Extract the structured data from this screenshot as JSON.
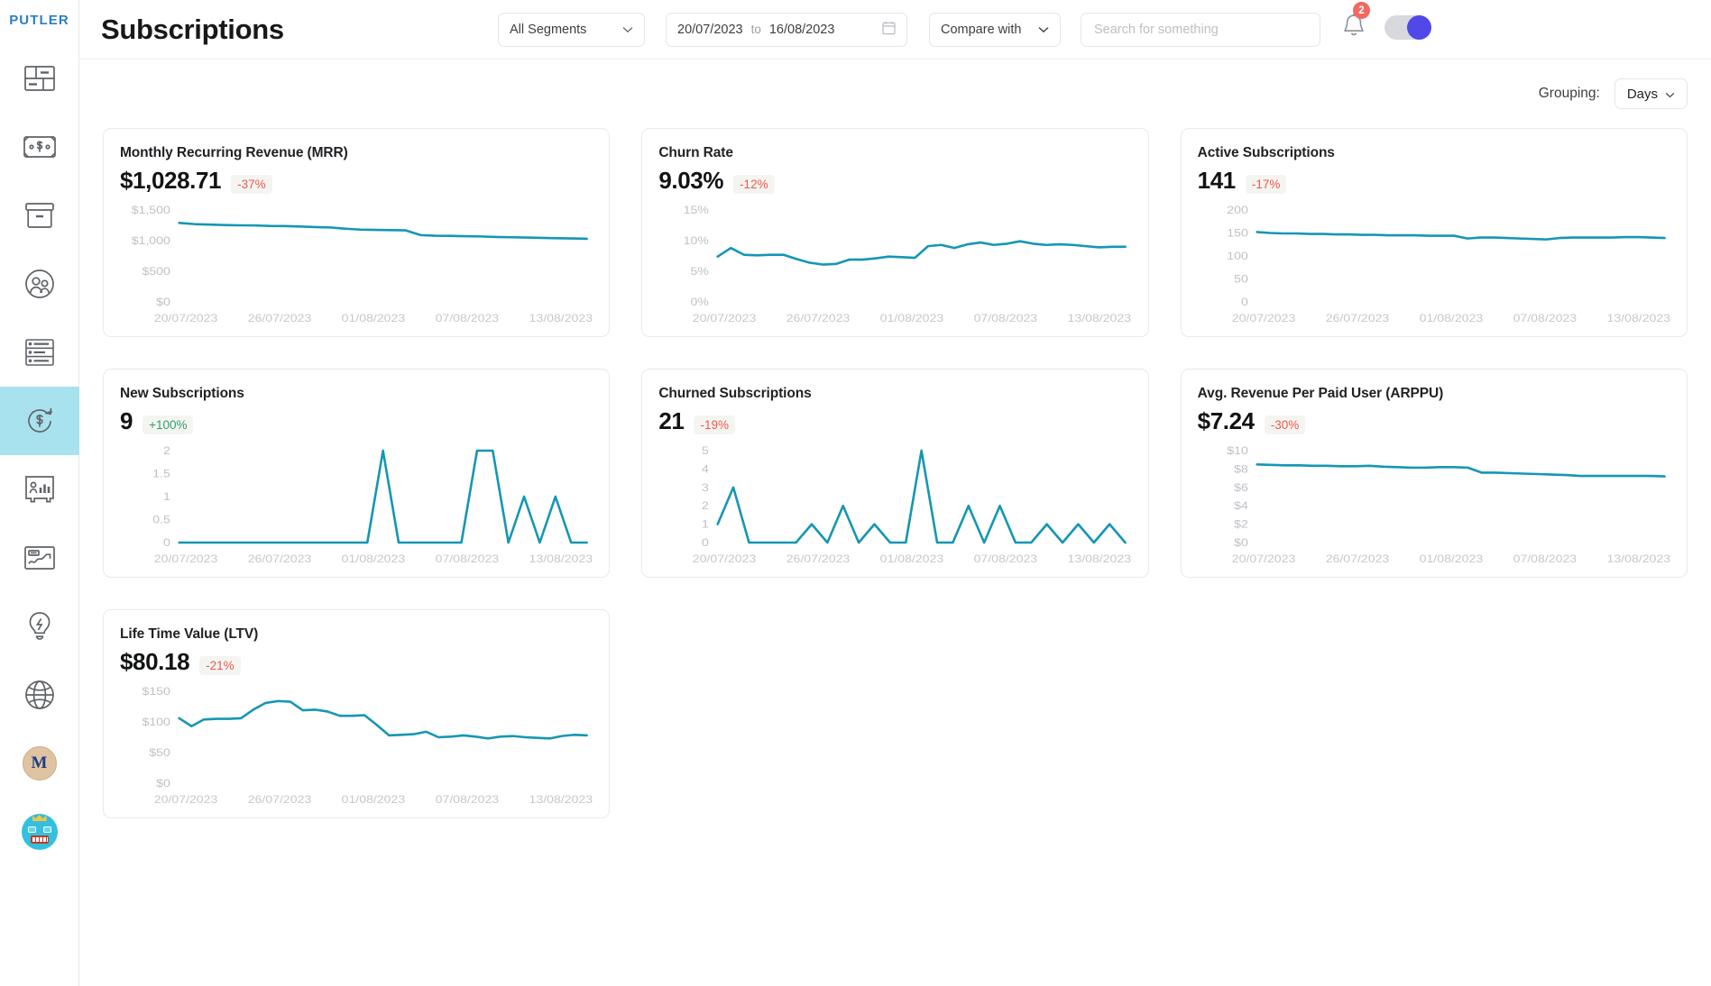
{
  "brand": "PUTLER",
  "sidebar": {
    "items": [
      {
        "name": "dashboard",
        "icon": "dashboard-icon",
        "active": false
      },
      {
        "name": "sales",
        "icon": "money-bill-icon",
        "active": false
      },
      {
        "name": "products",
        "icon": "box-icon",
        "active": false
      },
      {
        "name": "customers",
        "icon": "people-icon",
        "active": false
      },
      {
        "name": "transactions",
        "icon": "list-rows-icon",
        "active": false
      },
      {
        "name": "subscriptions",
        "icon": "dollar-refresh-icon",
        "active": true
      },
      {
        "name": "audience",
        "icon": "person-chart-icon",
        "active": false
      },
      {
        "name": "insights",
        "icon": "trend-chart-icon",
        "active": false
      },
      {
        "name": "ideas",
        "icon": "lightbulb-icon",
        "active": false
      },
      {
        "name": "web-analytics",
        "icon": "globe-icon",
        "active": false
      }
    ],
    "account_initial": "M"
  },
  "header": {
    "title": "Subscriptions",
    "segment_value": "All Segments",
    "date_from": "20/07/2023",
    "date_to_label": "to",
    "date_to": "16/08/2023",
    "compare_label": "Compare with",
    "search_placeholder": "Search for something",
    "search_value": "",
    "notification_count": "2",
    "toggle_on": true
  },
  "toolbar": {
    "grouping_label": "Grouping:",
    "grouping_value": "Days"
  },
  "colors": {
    "line": "#1596b4",
    "accent": "#2b7fc2",
    "active_nav": "#a9e2ef",
    "negative": "#f0574d",
    "positive": "#2e9e73",
    "badge": "#f4685f",
    "toggle_knob": "#5248e8"
  },
  "chart_data": [
    {
      "type": "line",
      "title": "Monthly Recurring Revenue (MRR)",
      "value": "$1,028.71",
      "delta": "-37%",
      "delta_sign": "neg",
      "xlabel": "",
      "ylabel": "",
      "ylim": [
        0,
        1500
      ],
      "yticks": [
        0,
        500,
        1000,
        1500
      ],
      "ytick_labels": [
        "$0",
        "$500",
        "$1,000",
        "$1,500"
      ],
      "xtick_labels": [
        "20/07/2023",
        "26/07/2023",
        "01/08/2023",
        "07/08/2023",
        "13/08/2023"
      ],
      "grid": false,
      "values": [
        1290,
        1270,
        1262,
        1255,
        1250,
        1248,
        1240,
        1238,
        1230,
        1222,
        1215,
        1195,
        1180,
        1175,
        1172,
        1168,
        1090,
        1080,
        1078,
        1072,
        1068,
        1060,
        1055,
        1050,
        1045,
        1040,
        1036,
        1030
      ]
    },
    {
      "type": "line",
      "title": "Churn Rate",
      "value": "9.03%",
      "delta": "-12%",
      "delta_sign": "neg",
      "xlabel": "",
      "ylabel": "",
      "ylim": [
        0,
        15
      ],
      "yticks": [
        0,
        5,
        10,
        15
      ],
      "ytick_labels": [
        "0%",
        "5%",
        "10%",
        "15%"
      ],
      "xtick_labels": [
        "20/07/2023",
        "26/07/2023",
        "01/08/2023",
        "07/08/2023",
        "13/08/2023"
      ],
      "grid": false,
      "values": [
        7.4,
        8.8,
        7.7,
        7.6,
        7.7,
        7.7,
        7.0,
        6.4,
        6.1,
        6.2,
        6.9,
        6.9,
        7.1,
        7.4,
        7.3,
        7.2,
        9.1,
        9.3,
        8.8,
        9.4,
        9.7,
        9.3,
        9.5,
        9.9,
        9.5,
        9.3,
        9.4,
        9.3,
        9.1,
        8.9,
        9.0,
        9.0
      ]
    },
    {
      "type": "line",
      "title": "Active Subscriptions",
      "value": "141",
      "delta": "-17%",
      "delta_sign": "neg",
      "xlabel": "",
      "ylabel": "",
      "ylim": [
        0,
        200
      ],
      "yticks": [
        0,
        50,
        100,
        150,
        200
      ],
      "ytick_labels": [
        "0",
        "50",
        "100",
        "150",
        "200"
      ],
      "xtick_labels": [
        "20/07/2023",
        "26/07/2023",
        "01/08/2023",
        "07/08/2023",
        "13/08/2023"
      ],
      "grid": false,
      "values": [
        152,
        150,
        149,
        149,
        148,
        148,
        147,
        147,
        146,
        146,
        145,
        145,
        145,
        144,
        144,
        144,
        138,
        140,
        140,
        139,
        138,
        137,
        136,
        139,
        140,
        140,
        140,
        140,
        141,
        141,
        140,
        139
      ]
    },
    {
      "type": "line",
      "title": "New Subscriptions",
      "value": "9",
      "delta": "+100%",
      "delta_sign": "pos",
      "xlabel": "",
      "ylabel": "",
      "ylim": [
        0,
        2
      ],
      "yticks": [
        0,
        0.5,
        1,
        1.5,
        2
      ],
      "ytick_labels": [
        "0",
        "0.5",
        "1",
        "1.5",
        "2"
      ],
      "xtick_labels": [
        "20/07/2023",
        "26/07/2023",
        "01/08/2023",
        "07/08/2023",
        "13/08/2023"
      ],
      "grid": false,
      "values": [
        0,
        0,
        0,
        0,
        0,
        0,
        0,
        0,
        0,
        0,
        0,
        0,
        0,
        2,
        0,
        0,
        0,
        0,
        0,
        2,
        2,
        0,
        1,
        0,
        1,
        0,
        0
      ]
    },
    {
      "type": "line",
      "title": "Churned Subscriptions",
      "value": "21",
      "delta": "-19%",
      "delta_sign": "neg",
      "xlabel": "",
      "ylabel": "",
      "ylim": [
        0,
        5
      ],
      "yticks": [
        0,
        1,
        2,
        3,
        4,
        5
      ],
      "ytick_labels": [
        "0",
        "1",
        "2",
        "3",
        "4",
        "5"
      ],
      "xtick_labels": [
        "20/07/2023",
        "26/07/2023",
        "01/08/2023",
        "07/08/2023",
        "13/08/2023"
      ],
      "grid": false,
      "values": [
        1,
        3,
        0,
        0,
        0,
        0,
        1,
        0,
        2,
        0,
        1,
        0,
        0,
        5,
        0,
        0,
        2,
        0,
        2,
        0,
        0,
        1,
        0,
        1,
        0,
        1,
        0
      ]
    },
    {
      "type": "line",
      "title": "Avg. Revenue Per Paid User (ARPPU)",
      "value": "$7.24",
      "delta": "-30%",
      "delta_sign": "neg",
      "xlabel": "",
      "ylabel": "",
      "ylim": [
        0,
        10
      ],
      "yticks": [
        0,
        2,
        4,
        6,
        8,
        10
      ],
      "ytick_labels": [
        "$0",
        "$2",
        "$4",
        "$6",
        "$8",
        "$10"
      ],
      "xtick_labels": [
        "20/07/2023",
        "26/07/2023",
        "01/08/2023",
        "07/08/2023",
        "13/08/2023"
      ],
      "grid": false,
      "values": [
        8.5,
        8.45,
        8.4,
        8.4,
        8.35,
        8.35,
        8.3,
        8.3,
        8.35,
        8.25,
        8.2,
        8.15,
        8.15,
        8.2,
        8.2,
        8.15,
        7.6,
        7.6,
        7.55,
        7.5,
        7.45,
        7.4,
        7.35,
        7.25,
        7.25,
        7.25,
        7.25,
        7.25,
        7.25,
        7.2
      ]
    },
    {
      "type": "line",
      "title": "Life Time Value (LTV)",
      "value": "$80.18",
      "delta": "-21%",
      "delta_sign": "neg",
      "xlabel": "",
      "ylabel": "",
      "ylim": [
        0,
        150
      ],
      "yticks": [
        0,
        50,
        100,
        150
      ],
      "ytick_labels": [
        "$0",
        "$50",
        "$100",
        "$150"
      ],
      "xtick_labels": [
        "20/07/2023",
        "26/07/2023",
        "01/08/2023",
        "07/08/2023",
        "13/08/2023"
      ],
      "grid": false,
      "values": [
        106,
        93,
        104,
        105,
        105,
        106,
        120,
        131,
        134,
        133,
        119,
        120,
        117,
        110,
        110,
        111,
        95,
        78,
        79,
        80,
        84,
        75,
        76,
        78,
        76,
        73,
        76,
        77,
        75,
        74,
        73,
        77,
        79,
        78
      ]
    }
  ]
}
